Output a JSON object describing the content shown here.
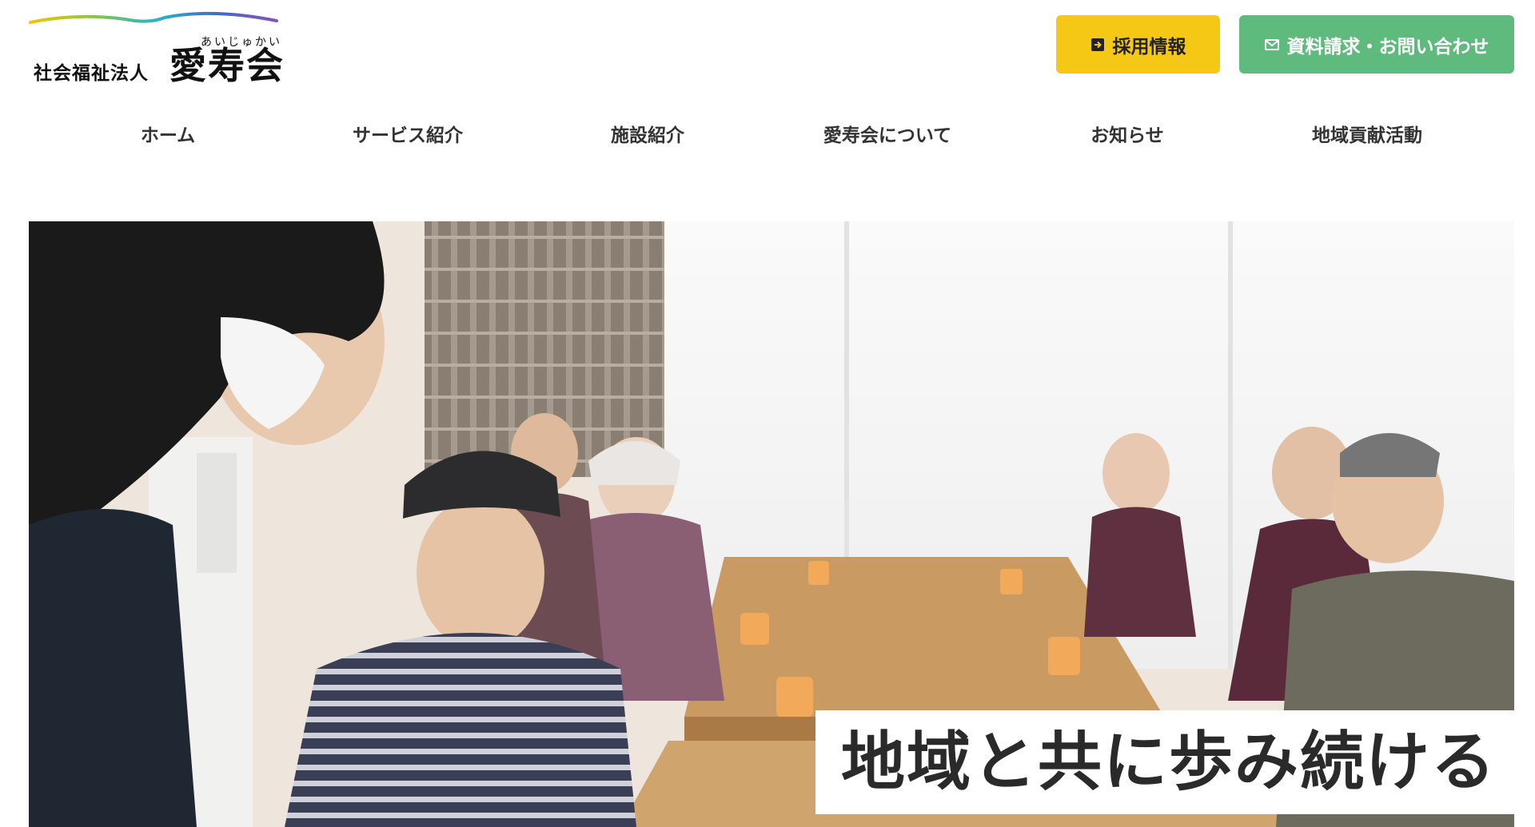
{
  "header": {
    "logo": {
      "prefix": "社会福祉法人",
      "name": "愛寿会",
      "ruby": "あいじゅかい"
    },
    "recruit_button": {
      "label": "採用情報",
      "icon": "arrow-right-box-icon"
    },
    "contact_button": {
      "label": "資料請求・お問い合わせ",
      "icon": "mail-icon"
    }
  },
  "nav": {
    "items": [
      {
        "label": "ホーム"
      },
      {
        "label": "サービス紹介"
      },
      {
        "label": "施設紹介"
      },
      {
        "label": "愛寿会について"
      },
      {
        "label": "お知らせ"
      },
      {
        "label": "地域貢献活動"
      }
    ]
  },
  "hero": {
    "caption": "地域と共に歩み続ける"
  },
  "colors": {
    "recruit": "#f6c816",
    "contact": "#5fba7d",
    "text": "#333333"
  }
}
